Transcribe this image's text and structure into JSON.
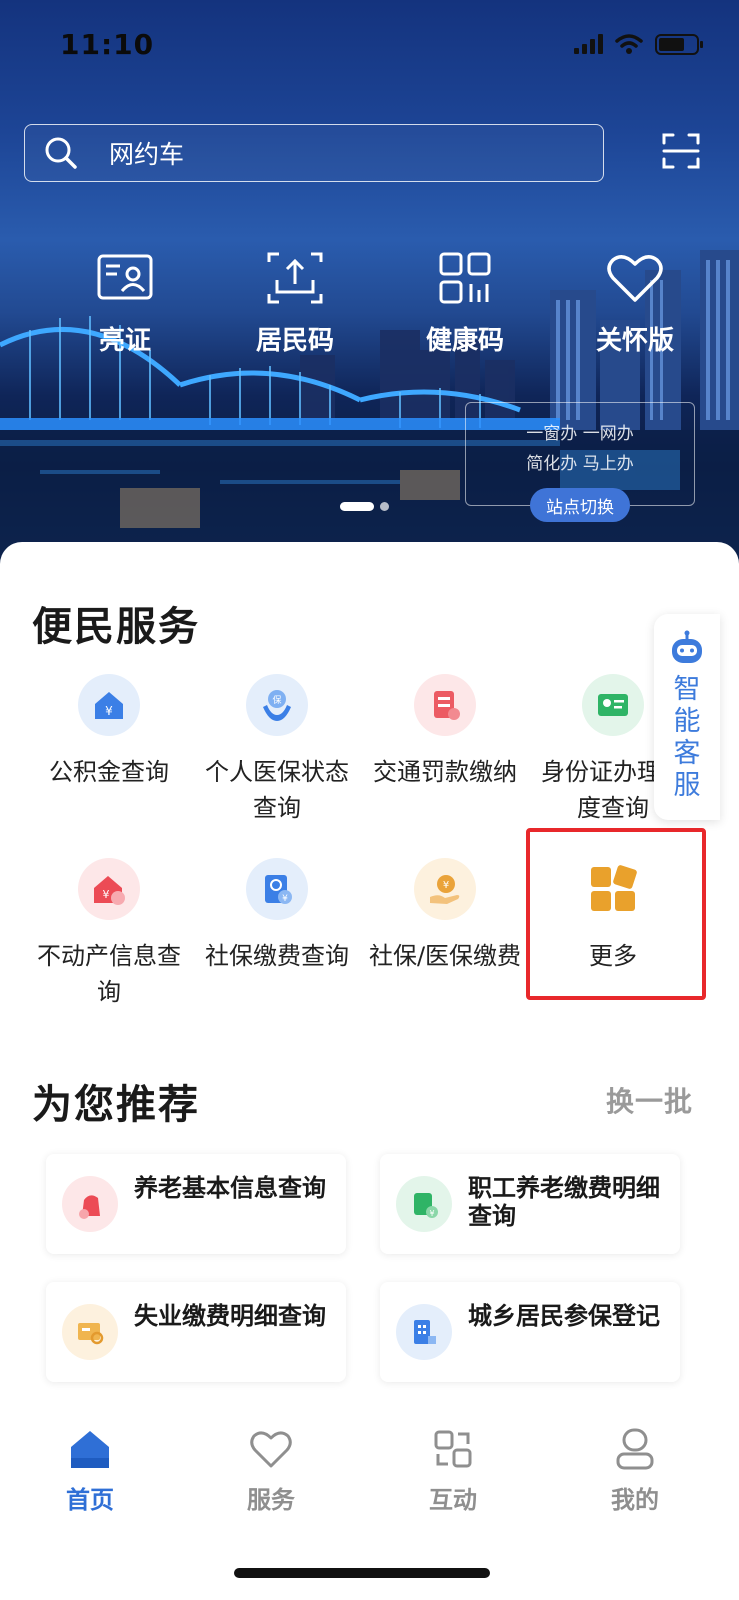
{
  "status": {
    "time": "11:10"
  },
  "search": {
    "placeholder": "网约车"
  },
  "quick_actions": [
    {
      "label": "亮证",
      "icon": "id-card-icon"
    },
    {
      "label": "居民码",
      "icon": "upload-code-icon"
    },
    {
      "label": "健康码",
      "icon": "qr-grid-icon"
    },
    {
      "label": "关怀版",
      "icon": "heart-icon"
    }
  ],
  "banner": {
    "slogan_line1": "一窗办 一网办",
    "slogan_line2": "简化办 马上办",
    "site_switch": "站点切换"
  },
  "services": {
    "title": "便民服务",
    "items": [
      {
        "label": "公积金查询",
        "icon": "house-fund-icon"
      },
      {
        "label": "个人医保状态查询",
        "icon": "medical-insurance-icon"
      },
      {
        "label": "交通罚款缴纳",
        "icon": "traffic-fine-icon"
      },
      {
        "label": "身份证办理进度查询",
        "icon": "id-progress-icon"
      },
      {
        "label": "不动产信息查询",
        "icon": "real-estate-icon"
      },
      {
        "label": "社保缴费查询",
        "icon": "social-security-icon"
      },
      {
        "label": "社保/医保缴费",
        "icon": "payment-icon"
      },
      {
        "label": "更多",
        "icon": "more-grid-icon"
      }
    ]
  },
  "assistant": {
    "label": "智能客服"
  },
  "recommend": {
    "title": "为您推荐",
    "refresh": "换一批",
    "items": [
      {
        "label": "养老基本信息查询",
        "icon": "pension-icon"
      },
      {
        "label": "职工养老缴费明细查询",
        "icon": "worker-pension-icon"
      },
      {
        "label": "失业缴费明细查询",
        "icon": "unemployment-icon"
      },
      {
        "label": "城乡居民参保登记",
        "icon": "resident-insurance-icon"
      }
    ]
  },
  "nav": [
    {
      "label": "首页",
      "icon": "home-icon"
    },
    {
      "label": "服务",
      "icon": "heart-outline-icon"
    },
    {
      "label": "互动",
      "icon": "interact-icon"
    },
    {
      "label": "我的",
      "icon": "profile-icon"
    }
  ],
  "colors": {
    "accent": "#2f6fd6",
    "highlight": "#e8282b",
    "more": "#e9a12c"
  }
}
